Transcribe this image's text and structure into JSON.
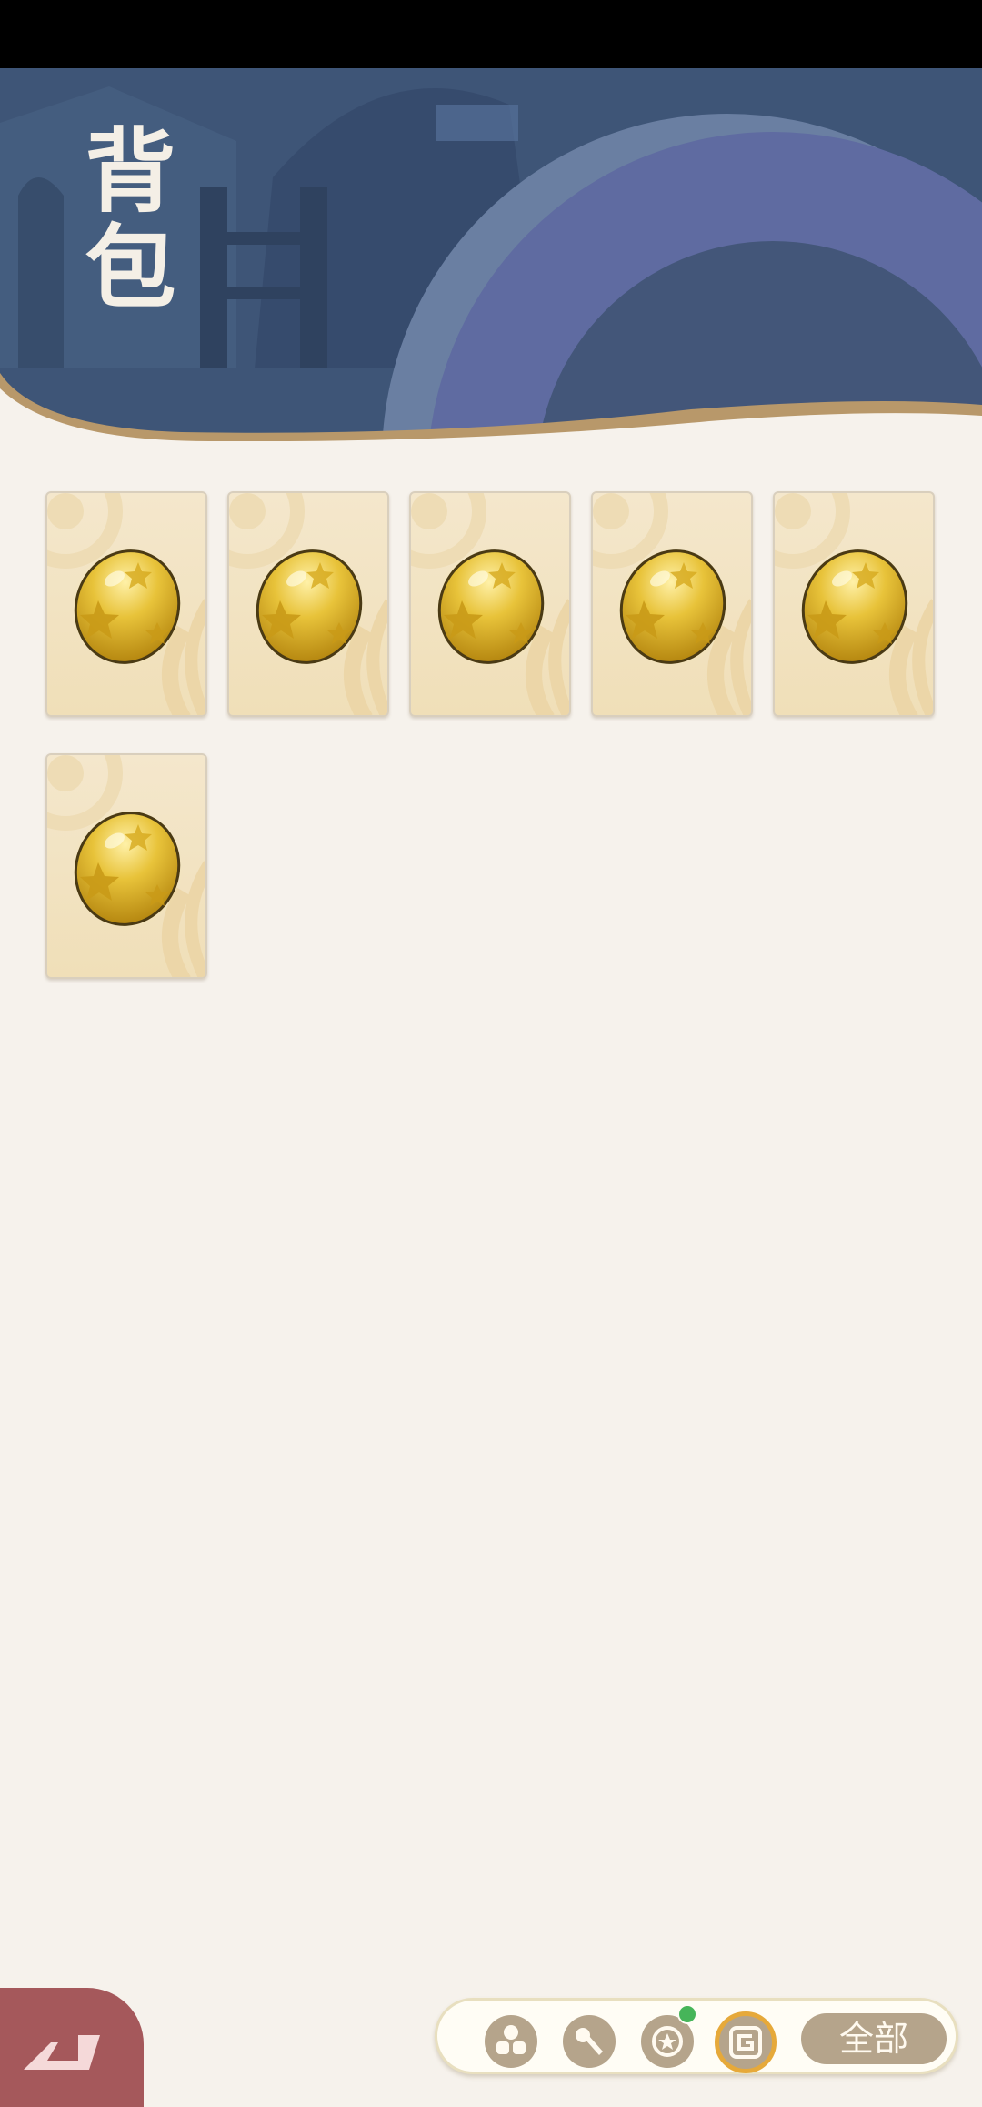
{
  "header": {
    "title": "背包"
  },
  "inventory": {
    "items": [
      {
        "icon": "golden-star-egg-icon"
      },
      {
        "icon": "golden-star-egg-icon"
      },
      {
        "icon": "golden-star-egg-icon"
      },
      {
        "icon": "golden-star-egg-icon"
      },
      {
        "icon": "golden-star-egg-icon"
      },
      {
        "icon": "golden-star-egg-icon"
      }
    ]
  },
  "toolbar": {
    "filters": [
      {
        "icon": "items-icon",
        "active": false
      },
      {
        "icon": "tool-icon",
        "active": false
      },
      {
        "icon": "star-badge-icon",
        "active": false,
        "notification": true
      },
      {
        "icon": "spiral-icon",
        "active": true
      }
    ],
    "all_label": "全部"
  },
  "colors": {
    "header_bg": "#3e5577",
    "accent_circle": "#5f6ba1",
    "wave": "#b8986a",
    "back_button": "#a5585b",
    "filter_button": "#b5a48b",
    "active_ring": "#e6a93a",
    "notification": "#46b559"
  }
}
